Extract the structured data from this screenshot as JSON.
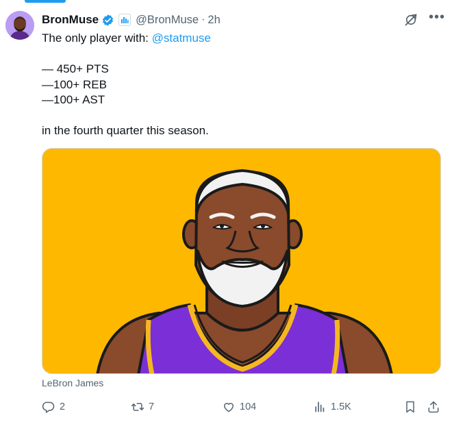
{
  "post": {
    "author_name": "BronMuse",
    "handle": "@BronMuse",
    "separator": "·",
    "time": "2h",
    "intro_text": "The only player with: ",
    "intro_mention": "@statmuse",
    "stat_lines": [
      "— 450+ PTS",
      "—100+ REB",
      "—100+ AST"
    ],
    "closing_text": "in the fourth quarter this season.",
    "media_caption": "LeBron James"
  },
  "actions": {
    "replies": "2",
    "reposts": "7",
    "likes": "104",
    "views": "1.5K"
  },
  "colors": {
    "accent": "#1d9bf0",
    "media_background": "#ffb800",
    "jersey": "#7b2fd6",
    "trim": "#f5b720"
  },
  "icons": [
    "verified-badge-icon",
    "affiliate-badge-icon",
    "grok-icon",
    "more-icon",
    "reply-icon",
    "repost-icon",
    "like-icon",
    "views-icon",
    "bookmark-icon",
    "share-icon"
  ]
}
